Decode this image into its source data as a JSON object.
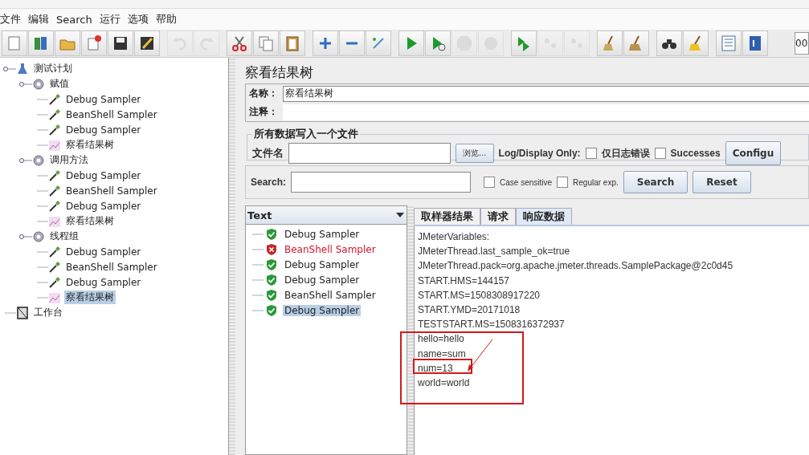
{
  "menu": [
    "文件",
    "编辑",
    "Search",
    "运行",
    "选项",
    "帮助"
  ],
  "toolbar": [
    {
      "kind": "new",
      "disabled": false
    },
    {
      "kind": "templates",
      "disabled": false
    },
    {
      "kind": "open",
      "disabled": false
    },
    {
      "kind": "close",
      "disabled": false
    },
    {
      "kind": "save",
      "disabled": false
    },
    {
      "kind": "edit",
      "disabled": false
    },
    {
      "kind": "undo",
      "disabled": true
    },
    {
      "kind": "redo",
      "disabled": true
    },
    {
      "kind": "cut",
      "disabled": false
    },
    {
      "kind": "copy",
      "disabled": false
    },
    {
      "kind": "paste",
      "disabled": false
    },
    {
      "kind": "add",
      "disabled": false
    },
    {
      "kind": "remove",
      "disabled": false
    },
    {
      "kind": "toggle",
      "disabled": false
    },
    {
      "kind": "start",
      "disabled": false
    },
    {
      "kind": "start-nopause",
      "disabled": false
    },
    {
      "kind": "stop",
      "disabled": true
    },
    {
      "kind": "shutdown",
      "disabled": true
    },
    {
      "kind": "remote-start",
      "disabled": false
    },
    {
      "kind": "remote-stop",
      "disabled": true
    },
    {
      "kind": "remote-exit",
      "disabled": true
    },
    {
      "kind": "clear",
      "disabled": false
    },
    {
      "kind": "clear-all",
      "disabled": false
    },
    {
      "kind": "search",
      "disabled": false
    },
    {
      "kind": "reset",
      "disabled": false
    },
    {
      "kind": "list",
      "disabled": false
    },
    {
      "kind": "help",
      "disabled": false
    }
  ],
  "toolbar_counter": "00",
  "tree": [
    {
      "label": "测试计划",
      "kind": "plan",
      "selected": false,
      "expanded": true,
      "children": [
        {
          "label": "赋值",
          "kind": "group",
          "selected": false,
          "expanded": true,
          "children": [
            {
              "label": "Debug Sampler",
              "kind": "sampler",
              "selected": false
            },
            {
              "label": "BeanShell Sampler",
              "kind": "sampler",
              "selected": false
            },
            {
              "label": "Debug Sampler",
              "kind": "sampler",
              "selected": false
            },
            {
              "label": "察看结果树",
              "kind": "listener",
              "selected": false
            }
          ]
        },
        {
          "label": "调用方法",
          "kind": "group",
          "selected": false,
          "expanded": true,
          "children": [
            {
              "label": "Debug Sampler",
              "kind": "sampler",
              "selected": false
            },
            {
              "label": "BeanShell Sampler",
              "kind": "sampler",
              "selected": false
            },
            {
              "label": "Debug Sampler",
              "kind": "sampler",
              "selected": false
            },
            {
              "label": "察看结果树",
              "kind": "listener",
              "selected": false
            }
          ]
        },
        {
          "label": "线程组",
          "kind": "group",
          "selected": false,
          "expanded": true,
          "children": [
            {
              "label": "Debug Sampler",
              "kind": "sampler",
              "selected": false
            },
            {
              "label": "BeanShell Sampler",
              "kind": "sampler",
              "selected": false
            },
            {
              "label": "Debug Sampler",
              "kind": "sampler",
              "selected": false
            },
            {
              "label": "察看结果树",
              "kind": "listener",
              "selected": true
            }
          ]
        }
      ]
    },
    {
      "label": "工作台",
      "kind": "workbench",
      "selected": false
    }
  ],
  "panel": {
    "title": "察看结果树",
    "name_label": "名称：",
    "name_value": "察看结果树",
    "comment_label": "注释：",
    "file_group": {
      "legend": "所有数据写入一个文件",
      "file_label": "文件名",
      "browse": "浏览...",
      "log_label": "Log/Display Only:",
      "checks": [
        {
          "label": "仅日志错误",
          "checked": false
        },
        {
          "label": "Successes",
          "checked": false
        }
      ],
      "configure": "Configu"
    },
    "search": {
      "label": "Search:",
      "checks": [
        {
          "label": "Case sensitive",
          "checked": false
        },
        {
          "label": "Regular exp.",
          "checked": false
        }
      ],
      "buttons": [
        "Search",
        "Reset"
      ]
    }
  },
  "renderer": "Text",
  "results": [
    {
      "label": "Debug Sampler",
      "kind": "ok",
      "selected": false
    },
    {
      "label": "BeanShell Sampler",
      "kind": "error",
      "selected": false
    },
    {
      "label": "Debug Sampler",
      "kind": "ok",
      "selected": false
    },
    {
      "label": "Debug Sampler",
      "kind": "ok",
      "selected": false
    },
    {
      "label": "BeanShell Sampler",
      "kind": "ok",
      "selected": false
    },
    {
      "label": "Debug Sampler",
      "kind": "ok",
      "selected": true
    }
  ],
  "tabs": [
    {
      "label": "取样器结果",
      "selected": false
    },
    {
      "label": "请求",
      "selected": false
    },
    {
      "label": "响应数据",
      "selected": true
    }
  ],
  "response": [
    "JMeterVariables:",
    "JMeterThread.last_sample_ok=true",
    "JMeterThread.pack=org.apache.jmeter.threads.SamplePackage@2c0d45",
    "START.HMS=144157",
    "START.MS=1508308917220",
    "START.YMD=20171018",
    "TESTSTART.MS=1508316372937",
    "hello=hello",
    "name=sum",
    "num=13",
    "world=world"
  ]
}
